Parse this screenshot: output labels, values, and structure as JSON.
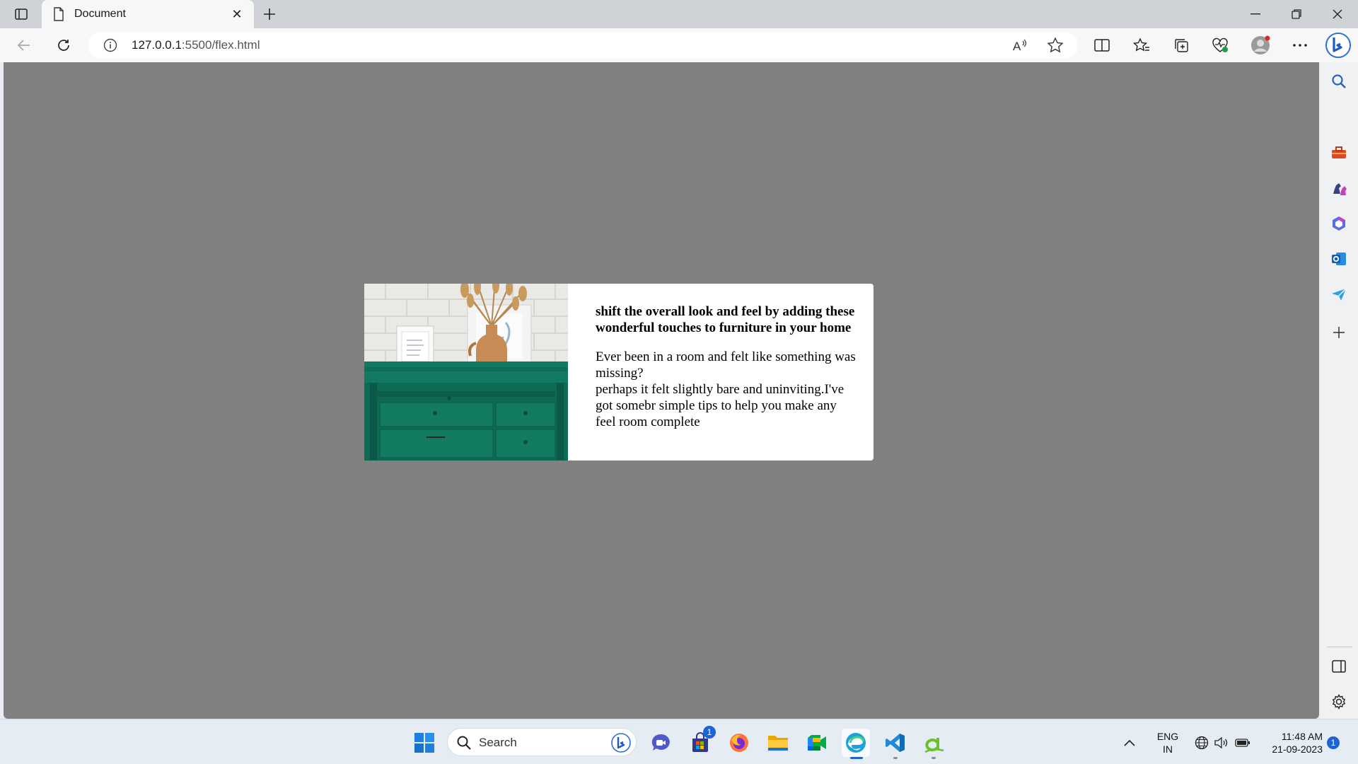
{
  "browser": {
    "tab_title": "Document",
    "url_host": "127.0.0.1",
    "url_rest": ":5500/flex.html"
  },
  "page": {
    "heading": "shift the overall look and feel by adding these wonderful touches to furniture in your home",
    "paragraph_line1": "Ever been in a room and felt like something was missing?",
    "paragraph_line2": "perhaps it felt slightly bare and uninviting.I've got somebr simple tips to help you make any feel room complete",
    "colors": {
      "background": "#808080",
      "card": "#ffffff",
      "dresser": "#0f6e58"
    }
  },
  "taskbar": {
    "search_placeholder": "Search",
    "store_badge": "1",
    "lang_top": "ENG",
    "lang_bottom": "IN",
    "time": "11:48 AM",
    "date": "21-09-2023",
    "notification_count": "1"
  },
  "icons": [
    "tab-actions-icon",
    "document-icon",
    "close-icon",
    "plus-icon",
    "minimize-icon",
    "restore-icon",
    "back-icon",
    "refresh-icon",
    "info-icon",
    "read-aloud-icon",
    "favorite-star-icon",
    "split-screen-icon",
    "favorites-icon",
    "collections-icon",
    "browser-essentials-icon",
    "profile-icon",
    "more-icon",
    "copilot-icon",
    "search-icon",
    "toolbox-icon",
    "games-icon",
    "office-icon",
    "outlook-icon",
    "send-icon",
    "settings-icon",
    "windows-icon",
    "chat-icon",
    "store-icon",
    "firefox-icon",
    "folder-icon",
    "meet-icon",
    "edge-icon",
    "vscode-icon",
    "app-icon",
    "chevron-up-icon",
    "globe-icon",
    "volume-icon",
    "battery-icon"
  ]
}
